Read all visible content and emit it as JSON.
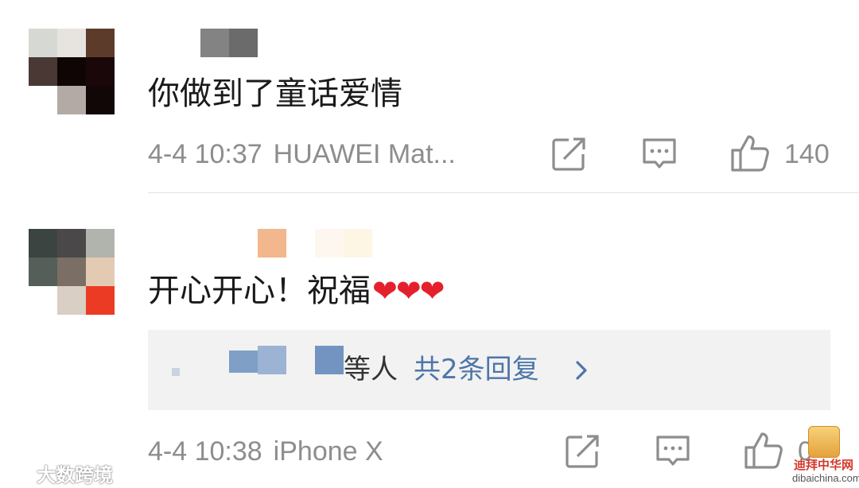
{
  "comments": [
    {
      "text": "你做到了童话爱情",
      "date_time": "4-4 10:37",
      "device": "HUAWEI Mat...",
      "like_count": "140"
    },
    {
      "text": "开心开心！祝福",
      "emoji": "❤❤❤",
      "date_time": "4-4 10:38",
      "device": "iPhone X",
      "like_count": "0",
      "replies": {
        "suffix": "等人",
        "link": "共2条回复",
        "chevron": "›"
      }
    }
  ],
  "colors": {
    "meta_gray": "#8d8d8d",
    "link_blue": "#4e76a8",
    "heart_red": "#e5202d",
    "reply_bg": "#f2f2f2"
  },
  "icons": [
    "edit-icon",
    "comment-icon",
    "thumb-up-icon",
    "chevron-right-icon"
  ],
  "watermarks": {
    "left": "大数跨境",
    "right_cn": "迪拜中华网",
    "right_en": "dibaichina.com"
  }
}
